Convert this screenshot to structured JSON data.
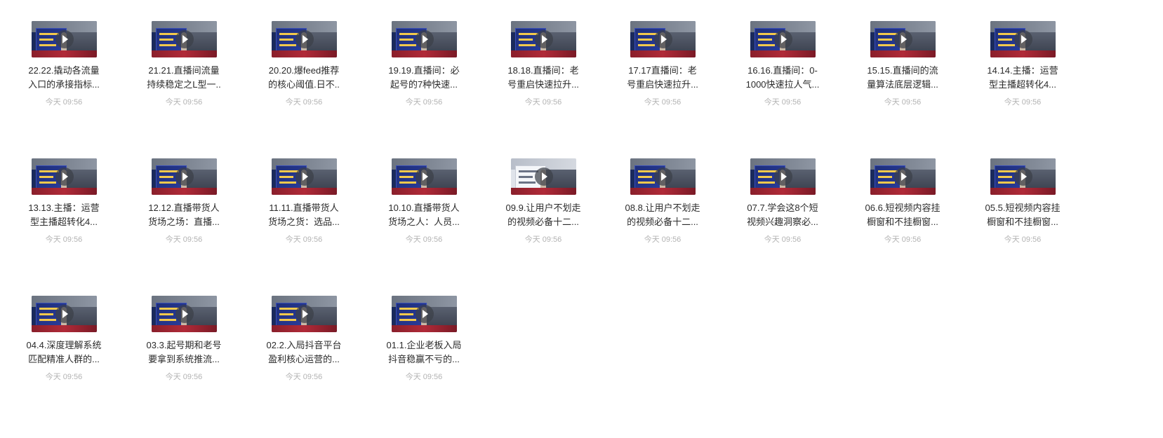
{
  "files": [
    {
      "line1": "22.22.撬动各流量",
      "line2": "入口的承接指标...",
      "time": "今天 09:56"
    },
    {
      "line1": "21.21.直播间流量",
      "line2": "持续稳定之L型一..",
      "time": "今天 09:56"
    },
    {
      "line1": "20.20.爆feed推荐",
      "line2": "的核心阈值.日不..",
      "time": "今天 09:56"
    },
    {
      "line1": "19.19.直播间：必",
      "line2": "起号的7种快速...",
      "time": "今天 09:56"
    },
    {
      "line1": "18.18.直播间：老",
      "line2": "号重启快速拉升...",
      "time": "今天 09:56"
    },
    {
      "line1": "17.17直播间：老",
      "line2": "号重启快速拉升...",
      "time": "今天 09:56"
    },
    {
      "line1": "16.16.直播间：0-",
      "line2": "1000快速拉人气...",
      "time": "今天 09:56"
    },
    {
      "line1": "15.15.直播间的流",
      "line2": "量算法底层逻辑...",
      "time": "今天 09:56"
    },
    {
      "line1": "14.14.主播：运营",
      "line2": "型主播超转化4...",
      "time": "今天 09:56"
    },
    {
      "line1": "13.13.主播：运营",
      "line2": "型主播超转化4...",
      "time": "今天 09:56"
    },
    {
      "line1": "12.12.直播带货人",
      "line2": "货场之场：直播...",
      "time": "今天 09:56"
    },
    {
      "line1": "11.11.直播带货人",
      "line2": "货场之货：选品...",
      "time": "今天 09:56"
    },
    {
      "line1": "10.10.直播带货人",
      "line2": "货场之人：人员...",
      "time": "今天 09:56"
    },
    {
      "line1": "09.9.让用户不划走",
      "line2": "的视频必备十二...",
      "time": "今天 09:56"
    },
    {
      "line1": "08.8.让用户不划走",
      "line2": "的视频必备十二...",
      "time": "今天 09:56"
    },
    {
      "line1": "07.7.学会这8个短",
      "line2": "视频兴趣洞察必...",
      "time": "今天 09:56"
    },
    {
      "line1": "06.6.短视频内容挂",
      "line2": "橱窗和不挂橱窗...",
      "time": "今天 09:56"
    },
    {
      "line1": "05.5.短视频内容挂",
      "line2": "橱窗和不挂橱窗...",
      "time": "今天 09:56"
    },
    {
      "line1": "04.4.深度理解系统",
      "line2": "匹配精准人群的...",
      "time": "今天 09:56"
    },
    {
      "line1": "03.3.起号期和老号",
      "line2": "要拿到系统推流...",
      "time": "今天 09:56"
    },
    {
      "line1": "02.2.入局抖音平台",
      "line2": "盈利核心运营的...",
      "time": "今天 09:56"
    },
    {
      "line1": "01.1.企业老板入局",
      "line2": "抖音稳赢不亏的...",
      "time": "今天 09:56"
    }
  ]
}
